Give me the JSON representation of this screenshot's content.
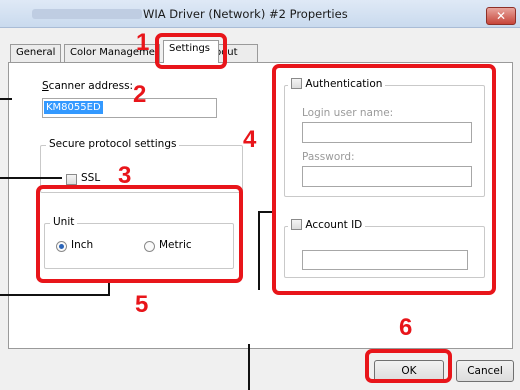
{
  "window": {
    "title": "WIA Driver (Network) #2 Properties",
    "close_glyph": "✕"
  },
  "tabs": [
    {
      "label": "General"
    },
    {
      "label": "Color Management"
    },
    {
      "label": "Settings"
    },
    {
      "label": "About"
    }
  ],
  "settings": {
    "scanner_address_label": "Scanner address:",
    "scanner_address_value": "KM8055ED",
    "secure_group_label": "Secure protocol settings",
    "ssl_label": "SSL",
    "unit_group_label": "Unit",
    "unit_options": [
      "Inch",
      "Metric"
    ],
    "unit_selected": "Inch"
  },
  "authentication": {
    "label": "Authentication",
    "login_label": "Login user name:",
    "login_value": "",
    "password_label": "Password:",
    "password_value": "",
    "account_id_label": "Account ID",
    "account_id_value": ""
  },
  "buttons": {
    "ok": "OK",
    "cancel": "Cancel"
  },
  "callouts": [
    "1",
    "2",
    "3",
    "4",
    "5",
    "6"
  ],
  "colors": {
    "callout_red": "#e8151a",
    "selection_blue": "#3399ff"
  }
}
